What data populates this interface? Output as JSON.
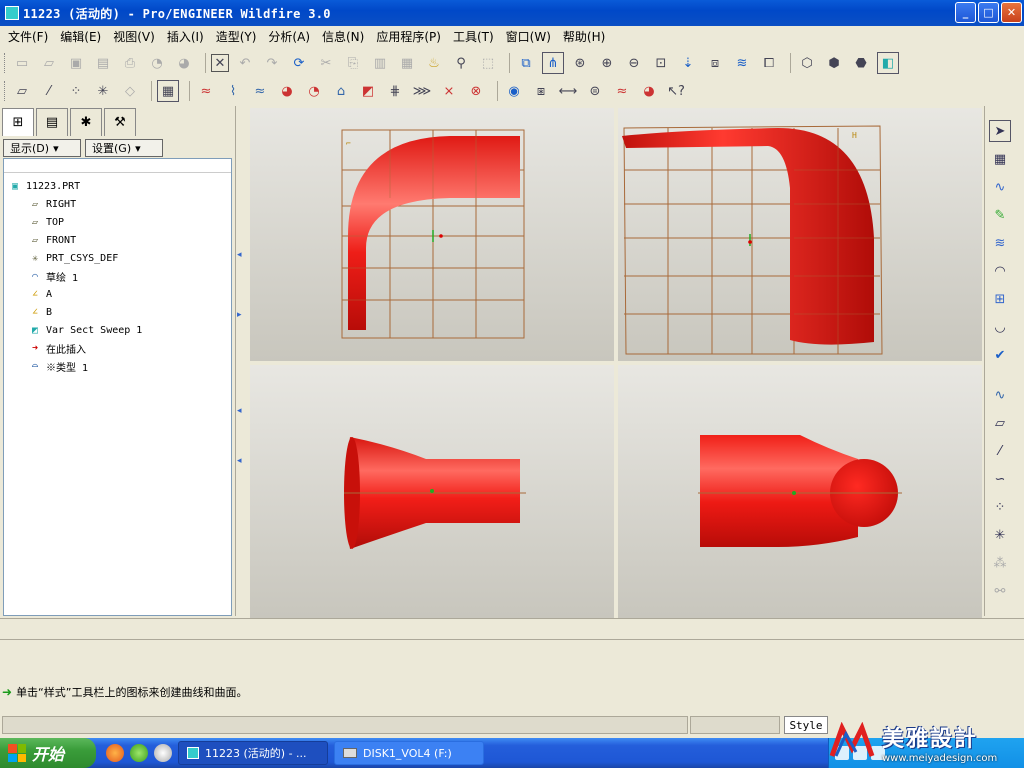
{
  "window": {
    "title": "11223 (活动的) - Pro/ENGINEER Wildfire 3.0",
    "buttons": {
      "minimize": "_",
      "maximize": "□",
      "close": "✕"
    }
  },
  "menu": [
    {
      "label": "文件(F)"
    },
    {
      "label": "编辑(E)"
    },
    {
      "label": "视图(V)"
    },
    {
      "label": "插入(I)"
    },
    {
      "label": "造型(Y)"
    },
    {
      "label": "分析(A)"
    },
    {
      "label": "信息(N)"
    },
    {
      "label": "应用程序(P)"
    },
    {
      "label": "工具(T)"
    },
    {
      "label": "窗口(W)"
    },
    {
      "label": "帮助(H)"
    }
  ],
  "sidebar": {
    "display_button": "显示(D)",
    "settings_button": "设置(G)",
    "tree": {
      "root": "11223.PRT",
      "items": [
        {
          "label": "RIGHT",
          "icon": "datum-plane-icon"
        },
        {
          "label": "TOP",
          "icon": "datum-plane-icon"
        },
        {
          "label": "FRONT",
          "icon": "datum-plane-icon"
        },
        {
          "label": "PRT_CSYS_DEF",
          "icon": "csys-icon"
        },
        {
          "label": "草绘 1",
          "icon": "sketch-icon"
        },
        {
          "label": "A",
          "icon": "curve-icon"
        },
        {
          "label": "B",
          "icon": "curve-icon"
        },
        {
          "label": "Var Sect Sweep 1",
          "icon": "sweep-icon"
        },
        {
          "label": "在此插入",
          "icon": "insert-here-arrow-icon"
        },
        {
          "label": "※类型 1",
          "icon": "style-feature-icon"
        }
      ]
    }
  },
  "message": {
    "text": "单击“样式”工具栏上的图标来创建曲线和曲面。"
  },
  "status": {
    "style_tab": "Style"
  },
  "taskbar": {
    "start_label": "开始",
    "items": [
      {
        "label": "11223 (活动的) - ..."
      },
      {
        "label": "DISK1_VOL4 (F:)"
      }
    ]
  },
  "watermark": {
    "brand": "美雅設計",
    "url": "www.meiyadesign.com"
  },
  "colors": {
    "title_bar": "#0a5bd8",
    "model_red": "#e8201a",
    "grid_brown": "#a86a3a",
    "task_bar": "#245edb"
  }
}
